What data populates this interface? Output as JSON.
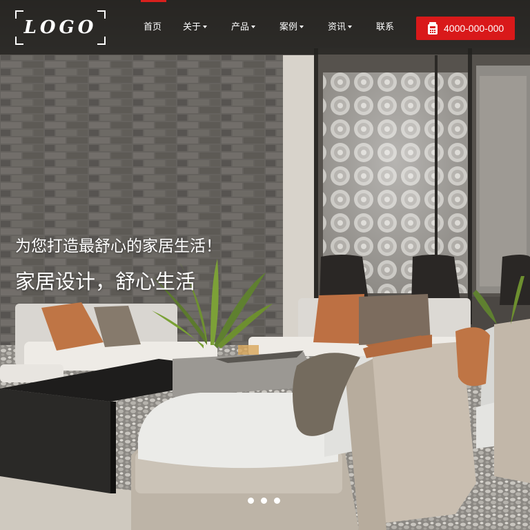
{
  "header": {
    "logo_text": "LOGO",
    "nav": [
      {
        "label": "首页",
        "dropdown": false,
        "active": true
      },
      {
        "label": "关于",
        "dropdown": true
      },
      {
        "label": "产品",
        "dropdown": true
      },
      {
        "label": "案例",
        "dropdown": true
      },
      {
        "label": "资讯",
        "dropdown": true
      },
      {
        "label": "联系",
        "dropdown": false
      }
    ],
    "phone": {
      "icon": "phone-icon",
      "number": "4000-000-000"
    }
  },
  "hero": {
    "headline": "为您打造最舒心的家居生活！",
    "subheadline": "家居设计，舒心生活",
    "slide_count": 3
  },
  "colors": {
    "accent": "#d9191a",
    "navbar": "#23211f",
    "text": "#ffffff"
  }
}
